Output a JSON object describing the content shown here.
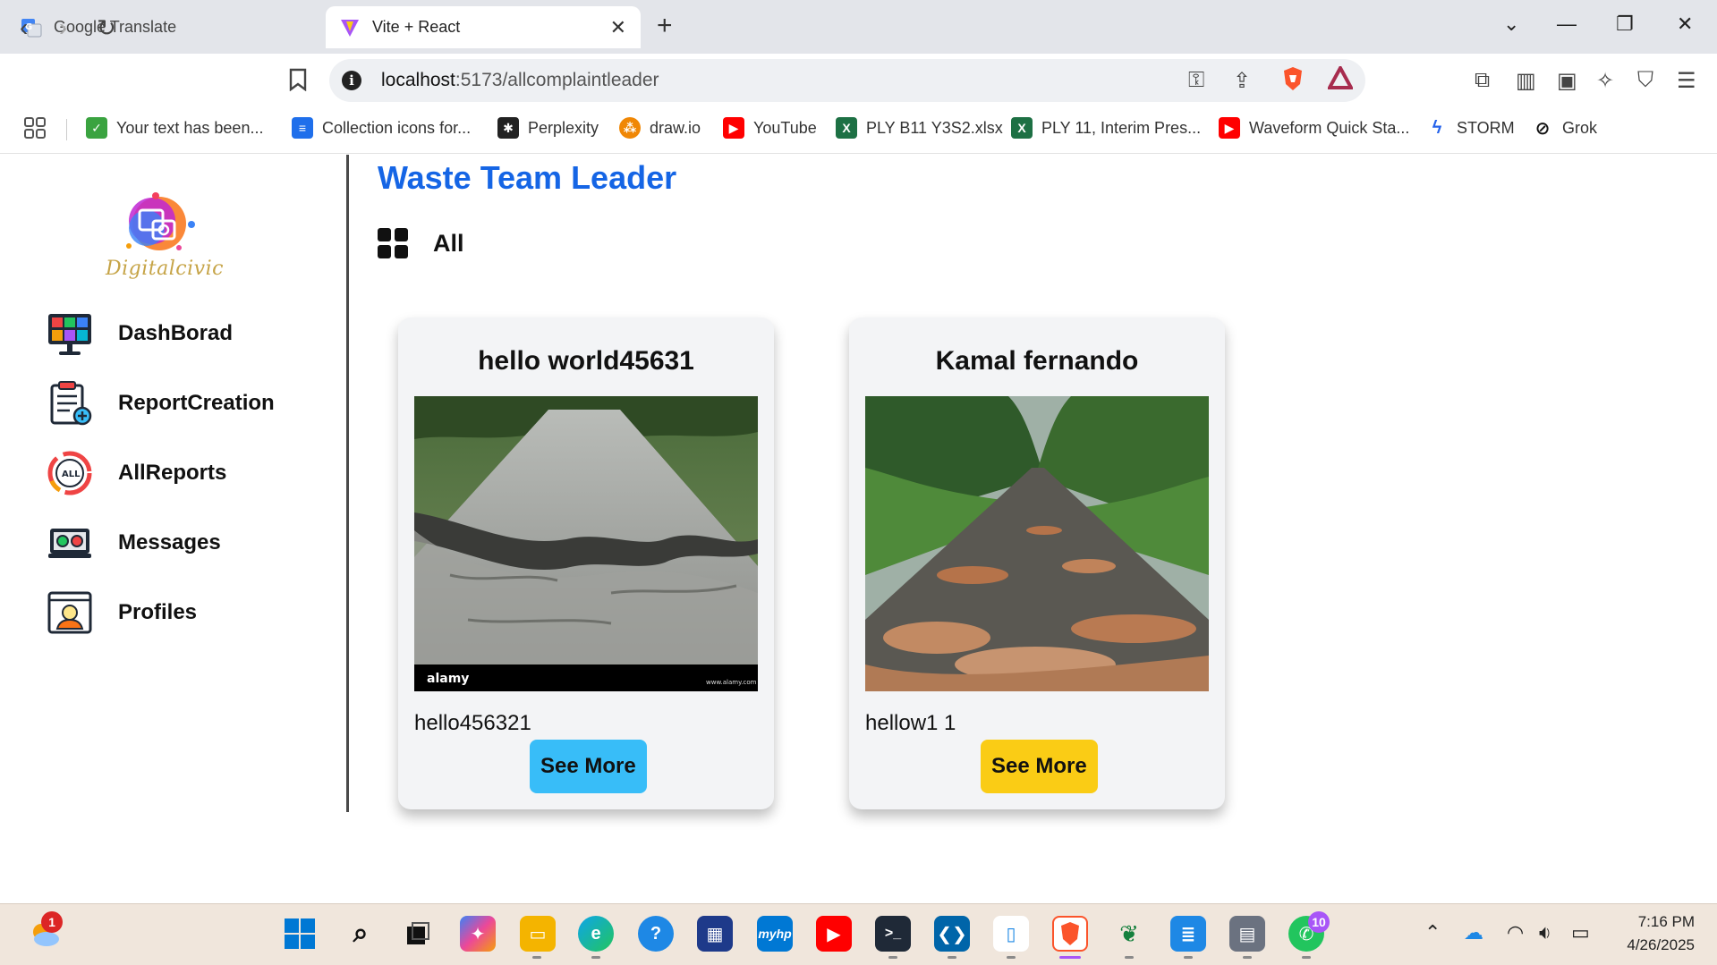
{
  "browser": {
    "tabs": [
      {
        "title": "Google Translate",
        "active": false
      },
      {
        "title": "Vite + React",
        "active": true
      }
    ],
    "new_tab_icon": "plus-icon",
    "url_host": "localhost",
    "url_path": ":5173/allcomplaintleader",
    "bookmarks": [
      {
        "label": "Your text has been...",
        "icon": "check-icon",
        "color": "#3aa340"
      },
      {
        "label": "Collection icons for...",
        "icon": "doc-icon",
        "color": "#1f6feb"
      },
      {
        "label": "Perplexity",
        "icon": "perplexity-icon",
        "color": "#222222"
      },
      {
        "label": "draw.io",
        "icon": "drawio-icon",
        "color": "#f08705"
      },
      {
        "label": "YouTube",
        "icon": "youtube-icon",
        "color": "#ff0000"
      },
      {
        "label": "PLY B11 Y3S2.xlsx",
        "icon": "excel-icon",
        "color": "#1d7044"
      },
      {
        "label": "PLY 11, Interim Pres...",
        "icon": "excel-icon",
        "color": "#1d7044"
      },
      {
        "label": "Waveform Quick Sta...",
        "icon": "youtube-icon",
        "color": "#ff0000"
      },
      {
        "label": "STORM",
        "icon": "lightning-icon",
        "color": "#2563eb"
      },
      {
        "label": "Grok",
        "icon": "grok-icon",
        "color": "#111111"
      }
    ]
  },
  "app": {
    "logo_text": "Digitalcivic",
    "page_title": "Waste Team Leader",
    "filter_label": "All",
    "sidebar": {
      "items": [
        {
          "label": "DashBorad",
          "icon": "dashboard-monitor-icon"
        },
        {
          "label": "ReportCreation",
          "icon": "clipboard-icon"
        },
        {
          "label": "AllReports",
          "icon": "all-reports-icon"
        },
        {
          "label": "Messages",
          "icon": "messages-laptop-icon"
        },
        {
          "label": "Profiles",
          "icon": "profile-card-icon"
        }
      ]
    },
    "cards": [
      {
        "title": "hello world45631",
        "description": "hello456321",
        "button": "See More",
        "button_color": "#38bdf8",
        "image_watermark": "alamy",
        "image_note": "www.alamy.com"
      },
      {
        "title": "Kamal fernando",
        "description": "hellow1 1",
        "button": "See More",
        "button_color": "#facc15"
      }
    ]
  },
  "taskbar": {
    "time": "7:16 PM",
    "date": "4/26/2025",
    "weather_badge": "1",
    "whatsapp_badge": "10"
  }
}
